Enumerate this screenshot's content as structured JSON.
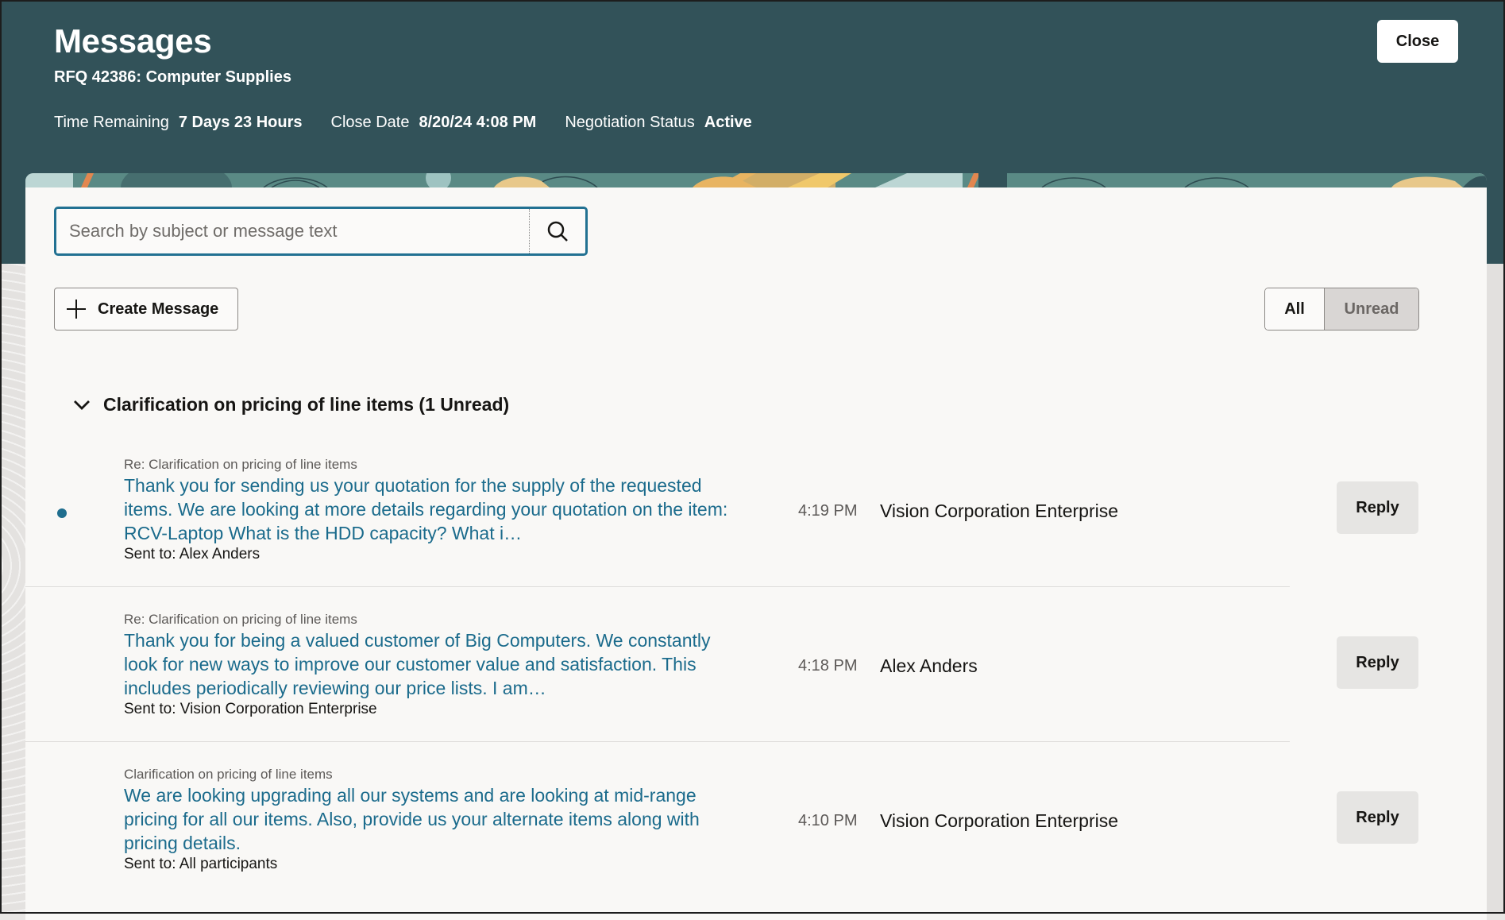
{
  "header": {
    "title": "Messages",
    "subtitle": "RFQ 42386: Computer Supplies",
    "meta": [
      {
        "label": "Time Remaining",
        "value": "7 Days 23 Hours"
      },
      {
        "label": "Close Date",
        "value": "8/20/24 4:08 PM"
      },
      {
        "label": "Negotiation Status",
        "value": "Active"
      }
    ],
    "close_label": "Close"
  },
  "search": {
    "placeholder": "Search by subject or message text",
    "value": "",
    "icon": "search-icon"
  },
  "toolbar": {
    "create_label": "Create Message",
    "create_icon": "plus-icon",
    "filter_options": [
      "All",
      "Unread"
    ],
    "filter_selected": "All"
  },
  "group": {
    "title": "Clarification on pricing of line items (1 Unread)",
    "expanded": true,
    "icon": "chevron-down-icon"
  },
  "messages": [
    {
      "unread": true,
      "subject": "Re: Clarification on pricing of line items",
      "body": "Thank you for sending us your quotation for the supply of the requested items. We are looking at more details regarding your quotation on the item: RCV-Laptop What is the HDD capacity? What i…",
      "sent_to": "Sent to: Alex Anders",
      "time": "4:19 PM",
      "sender": "Vision Corporation Enterprise",
      "reply_label": "Reply"
    },
    {
      "unread": false,
      "subject": "Re: Clarification on pricing of line items",
      "body": "Thank you for being a valued customer of Big Computers. We constantly look for new ways to improve our customer value and satisfaction. This includes periodically reviewing our price lists. I am…",
      "sent_to": "Sent to: Vision Corporation Enterprise",
      "time": "4:18 PM",
      "sender": "Alex Anders",
      "reply_label": "Reply"
    },
    {
      "unread": false,
      "subject": "Clarification on pricing of line items",
      "body": "We are looking upgrading all our systems and are looking at mid-range pricing for all our items. Also, provide us your alternate items along with pricing details.",
      "sent_to": "Sent to: All participants",
      "time": "4:10 PM",
      "sender": "Vision Corporation Enterprise",
      "reply_label": "Reply"
    }
  ],
  "colors": {
    "header_bg": "#325259",
    "accent_link": "#1b6b8c",
    "focus_border": "#227192",
    "unread_dot": "#1f6e8e",
    "card_bg": "#f9f8f6"
  }
}
